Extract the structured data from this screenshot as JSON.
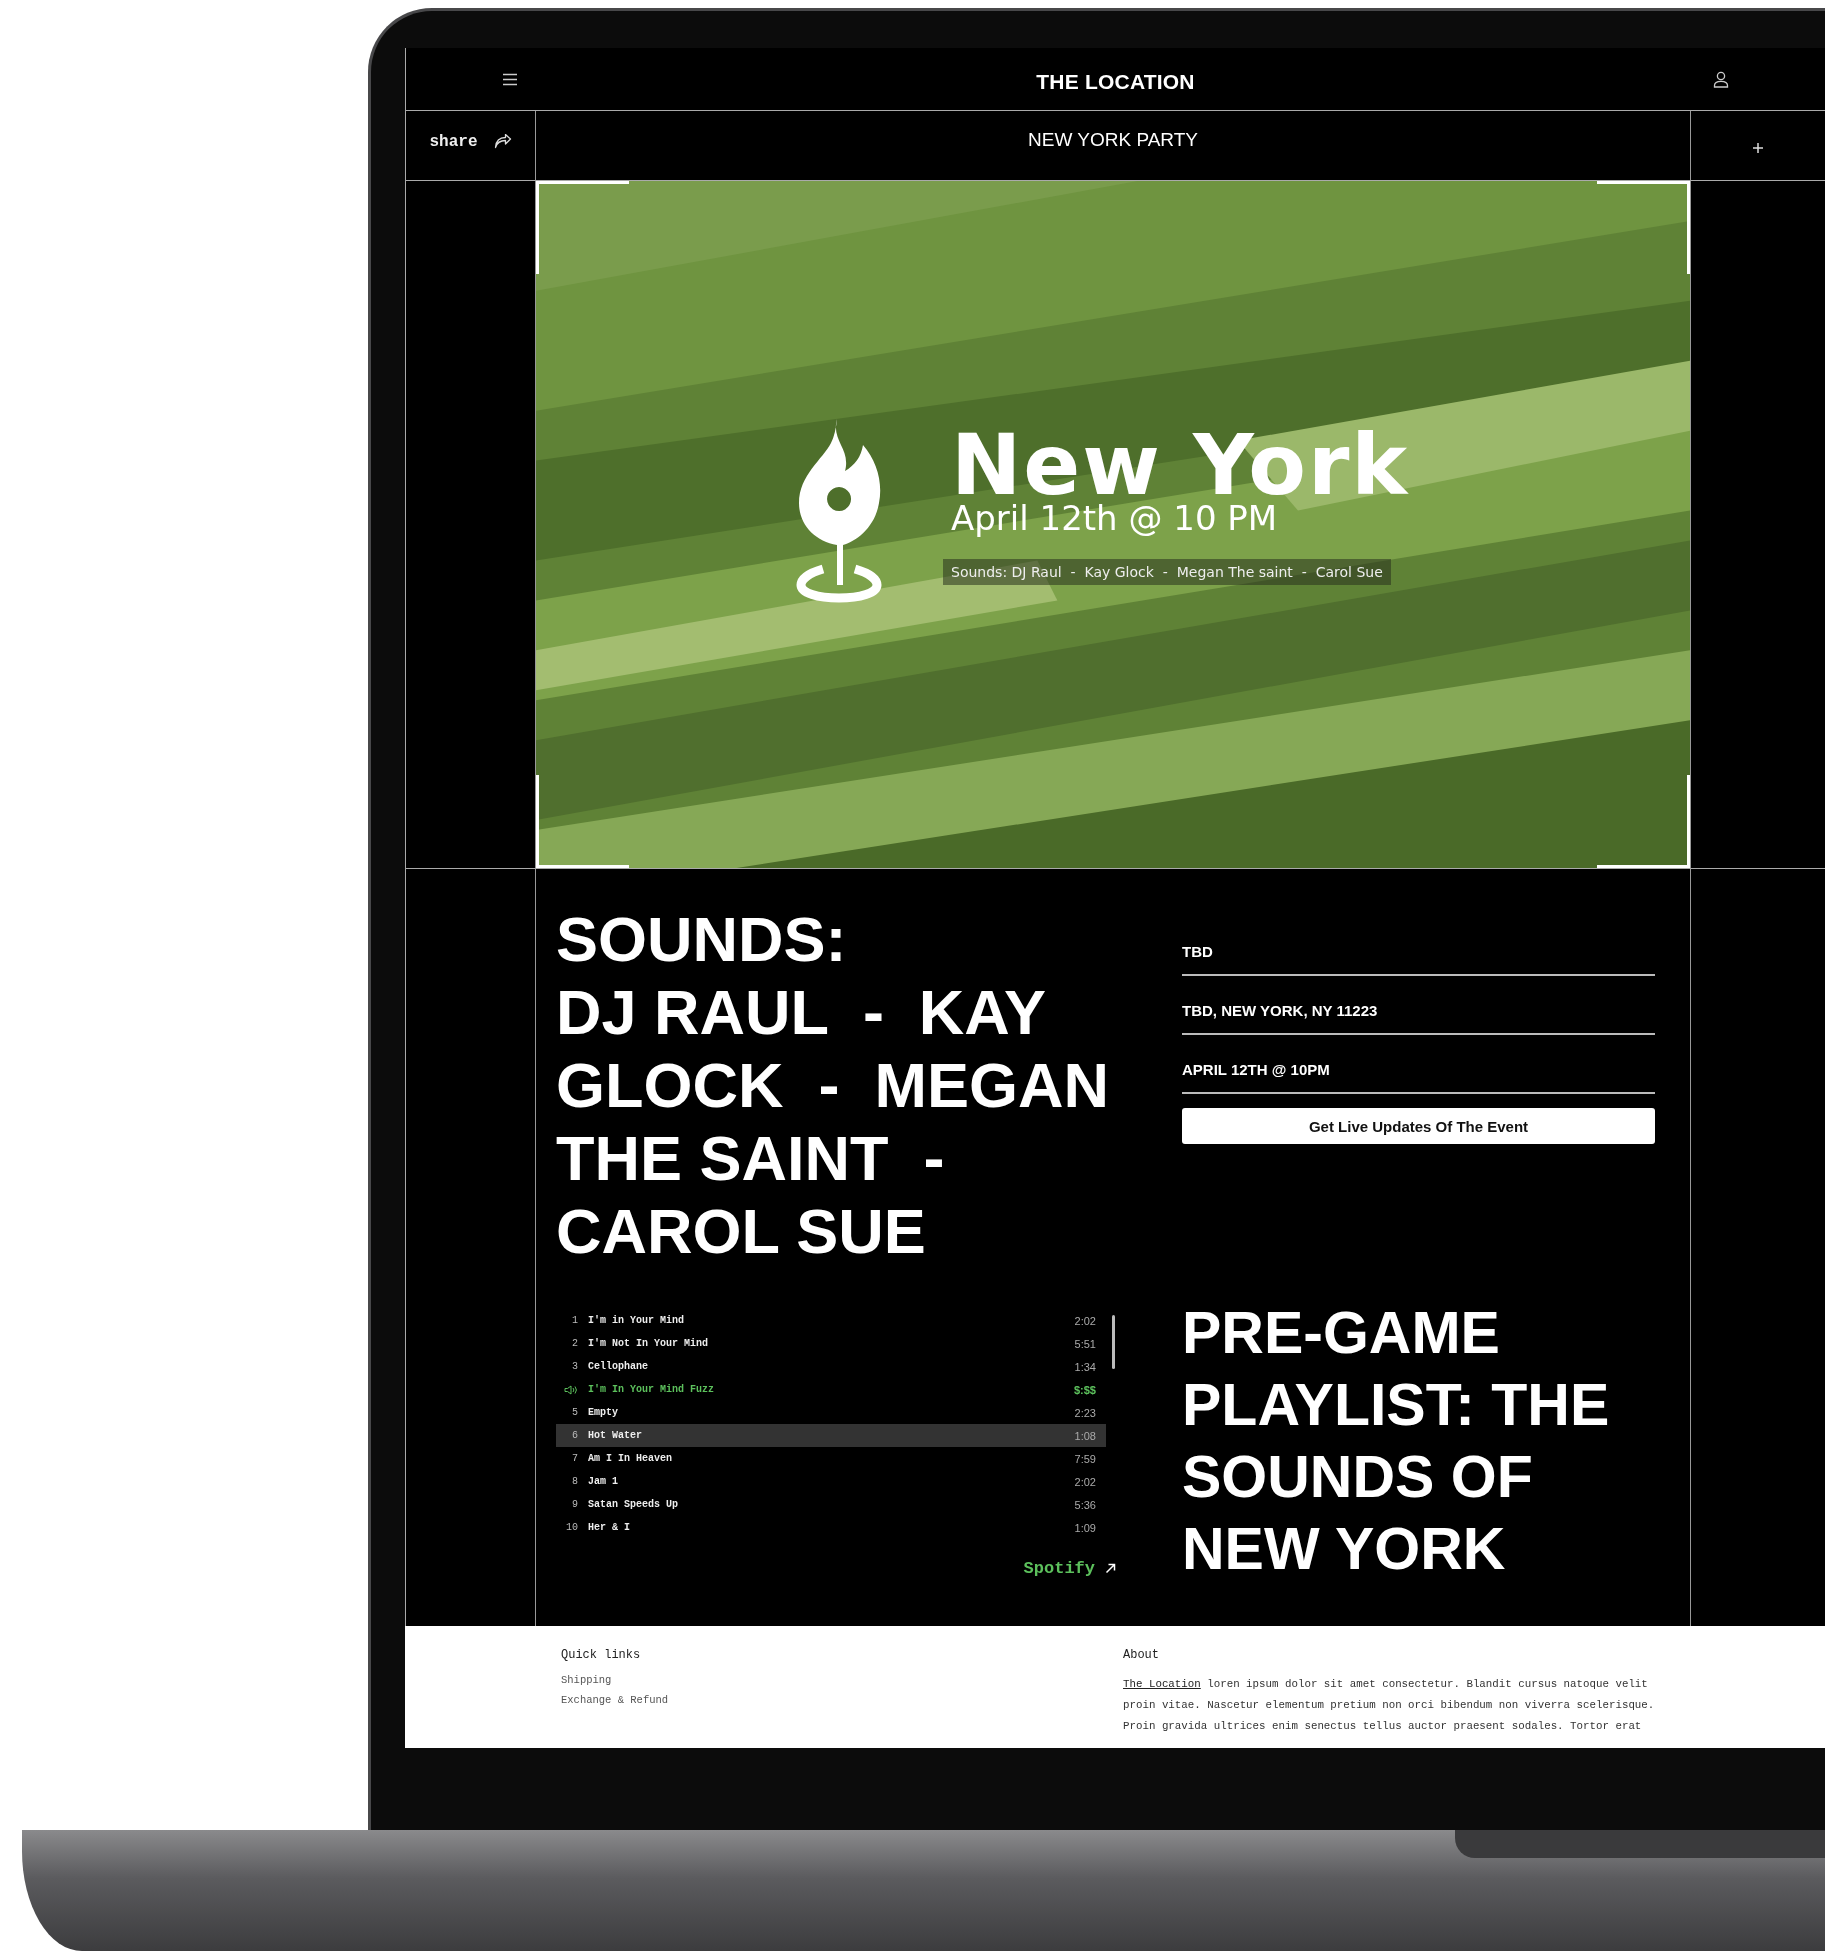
{
  "header": {
    "title": "THE LOCATION"
  },
  "subbar": {
    "share_label": "share",
    "title": "NEW YORK PARTY"
  },
  "hero": {
    "kind": "picture",
    "city": "New York",
    "date": "April 12th @ 10 PM",
    "sounds": "Sounds: DJ Raul  -  Kay Glock  -  Megan The saint  -  Carol Sue"
  },
  "lineup": {
    "heading": "SOUNDS:",
    "artists": "DJ RAUL  -  KAY GLOCK  -  MEGAN THE SAINT  -  CAROL SUE"
  },
  "details": [
    "TBD",
    "TBD, NEW YORK, NY 11223",
    "APRIL 12TH @ 10PM"
  ],
  "updates_button": "Get Live Updates Of The Event",
  "playlist": {
    "tracks": [
      {
        "number": "1",
        "title": "I'm in Your Mind",
        "duration": "2:02",
        "playing": false,
        "selected": false
      },
      {
        "number": "2",
        "title": "I'm Not In Your Mind",
        "duration": "5:51",
        "playing": false,
        "selected": false
      },
      {
        "number": "3",
        "title": "Cellophane",
        "duration": "1:34",
        "playing": false,
        "selected": false
      },
      {
        "title": "I'm In Your Mind Fuzz",
        "duration": "$:$$",
        "playing": true,
        "selected": false
      },
      {
        "number": "5",
        "title": "Empty",
        "duration": "2:23",
        "playing": false,
        "selected": false
      },
      {
        "number": "6",
        "title": "Hot Water",
        "duration": "1:08",
        "playing": false,
        "selected": true
      },
      {
        "number": "7",
        "title": "Am I In Heaven",
        "duration": "7:59",
        "playing": false,
        "selected": false
      },
      {
        "number": "8",
        "title": "Jam 1",
        "duration": "2:02",
        "playing": false,
        "selected": false
      },
      {
        "number": "9",
        "title": "Satan Speeds Up",
        "duration": "5:36",
        "playing": false,
        "selected": false
      },
      {
        "number": "10",
        "title": "Her & I",
        "duration": "1:09",
        "playing": false,
        "selected": false
      }
    ],
    "link": "Spotify"
  },
  "playlist_title": "PRE-GAME PLAYLIST: THE SOUNDS OF NEW YORK",
  "footer": {
    "quick_links": {
      "title": "Quick links",
      "items": [
        "Shipping",
        "Exchange & Refund"
      ]
    },
    "about": {
      "title": "About",
      "link": "The Location",
      "text": "loren ipsum dolor sit amet consectetur. Blandit cursus natoque velit proin vitae. Nascetur elementum pretium non orci bibendum non viverra scelerisque. Proin gravida ultrices enim senectus tellus auctor praesent sodales. Tortor erat"
    }
  }
}
